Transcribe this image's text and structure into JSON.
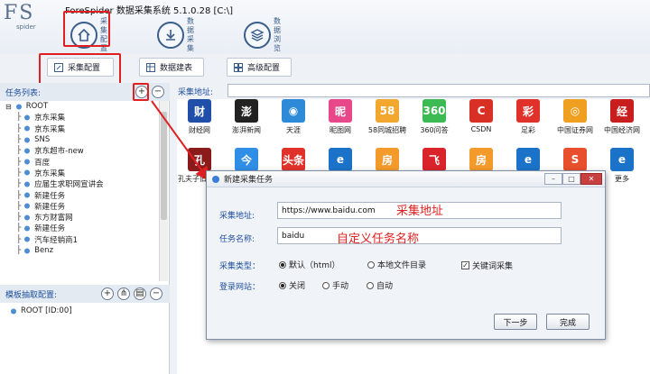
{
  "app": {
    "logo": "FS",
    "logo_sub": "spider",
    "title": "ForeSpider 数据采集系统  5.1.0.28  [C:\\]"
  },
  "nav": [
    {
      "label": "采集配置",
      "icon": "home-icon"
    },
    {
      "label": "数据采集",
      "icon": "download-icon"
    },
    {
      "label": "数据浏览",
      "icon": "layers-icon"
    }
  ],
  "toolbar": {
    "config_label": "采集配置",
    "data_build_label": "数据建表",
    "advanced_label": "高级配置"
  },
  "tasks": {
    "header": "任务列表:",
    "root": "ROOT",
    "items": [
      "京东采集",
      "京东采集",
      "SNS",
      "京东超市-new",
      "百度",
      "京东采集",
      "应届生求职网宣讲会",
      "新建任务",
      "新建任务",
      "东方财富网",
      "新建任务",
      "汽车经销商1",
      "Benz"
    ]
  },
  "template": {
    "header": "模板抽取配置:",
    "root": "ROOT [ID:00]"
  },
  "address": {
    "label": "采集地址:"
  },
  "sites_row1": [
    {
      "name": "财经网",
      "glyph": "财",
      "color": "#1f4fa8"
    },
    {
      "name": "澎湃新闻",
      "glyph": "澎",
      "color": "#222222"
    },
    {
      "name": "天涯",
      "glyph": "◉",
      "color": "#2c8ad8"
    },
    {
      "name": "昵图网",
      "glyph": "昵",
      "color": "#e8488a"
    },
    {
      "name": "58同城招聘",
      "glyph": "58",
      "color": "#f2a72f"
    },
    {
      "name": "360问答",
      "glyph": "360",
      "color": "#3cba54"
    },
    {
      "name": "CSDN",
      "glyph": "C",
      "color": "#d93025"
    },
    {
      "name": "足彩",
      "glyph": "彩",
      "color": "#e0322b"
    },
    {
      "name": "中国证券网",
      "glyph": "◎",
      "color": "#f0a020"
    },
    {
      "name": "中国经济网",
      "glyph": "经",
      "color": "#c81e1e"
    }
  ],
  "sites_row2": [
    {
      "name": "孔夫子旧书网",
      "glyph": "孔",
      "color": "#8b1a1a"
    },
    {
      "name": "",
      "glyph": "今",
      "color": "#2f8fe6"
    },
    {
      "name": "",
      "glyph": "头条",
      "color": "#e0322b"
    },
    {
      "name": "",
      "glyph": "e",
      "color": "#1b73c9"
    },
    {
      "name": "",
      "glyph": "房",
      "color": "#f39a2b"
    },
    {
      "name": "",
      "glyph": "飞",
      "color": "#d8242a"
    },
    {
      "name": "",
      "glyph": "房",
      "color": "#f39a2b"
    },
    {
      "name": "",
      "glyph": "e",
      "color": "#1b73c9"
    },
    {
      "name": "",
      "glyph": "S",
      "color": "#e8502d"
    },
    {
      "name": "更多",
      "glyph": "e",
      "color": "#1b73c9"
    }
  ],
  "dialog": {
    "title": "新建采集任务",
    "addr_label": "采集地址:",
    "addr_value": "https://www.baidu.com",
    "addr_anno": "采集地址",
    "name_label": "任务名称:",
    "name_value": "baidu",
    "name_anno": "自定义任务名称",
    "type_label": "采集类型：",
    "type_opt1": "默认（html）",
    "type_opt2": "本地文件目录",
    "keyword_label": "关键词采集",
    "login_label": "登录网站：",
    "login_opt1": "关闭",
    "login_opt2": "手动",
    "login_opt3": "自动",
    "next_label": "下一步",
    "done_label": "完成"
  },
  "colors": {
    "accent": "#1e4f9c",
    "highlight": "#e02020"
  }
}
